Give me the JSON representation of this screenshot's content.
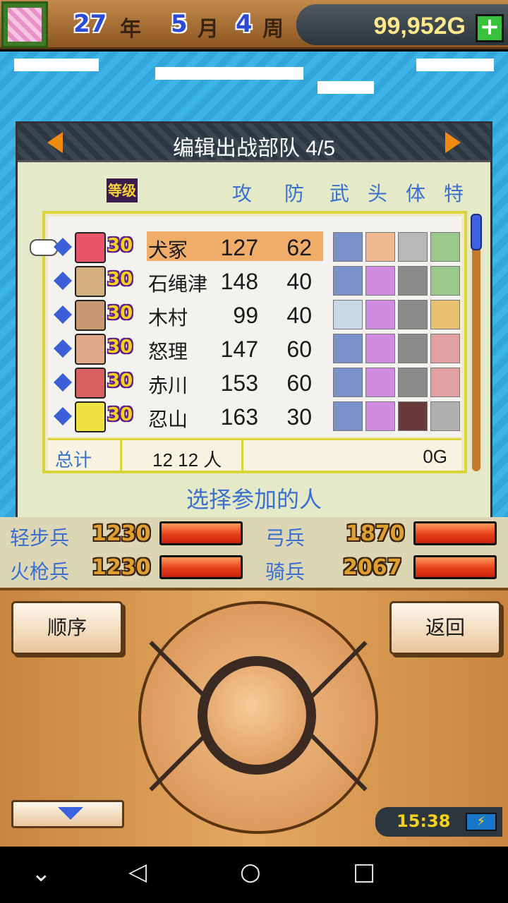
{
  "header": {
    "year": "27",
    "year_unit": "年",
    "month": "5",
    "month_unit": "月",
    "week": "4",
    "week_unit": "周",
    "gold": "99,952G",
    "plus_label": "+"
  },
  "dialog": {
    "title": "编辑出战部队 4/5",
    "level_header": "等级",
    "columns": [
      "攻",
      "防",
      "武",
      "头",
      "体",
      "特"
    ],
    "units": [
      {
        "level": "30",
        "name": "犬冢",
        "attack": "127",
        "defense": "62",
        "selected": true
      },
      {
        "level": "30",
        "name": "石绳津",
        "attack": "148",
        "defense": "40",
        "selected": false
      },
      {
        "level": "30",
        "name": "木村",
        "attack": "99",
        "defense": "40",
        "selected": false
      },
      {
        "level": "30",
        "name": "怒理",
        "attack": "147",
        "defense": "60",
        "selected": false
      },
      {
        "level": "30",
        "name": "赤川",
        "attack": "153",
        "defense": "60",
        "selected": false
      },
      {
        "level": "30",
        "name": "忍山",
        "attack": "163",
        "defense": "30",
        "selected": false
      }
    ],
    "total_label": "总计",
    "total_count": "12  12 人",
    "total_gold": "0G",
    "hint": "选择参加的人"
  },
  "troops": [
    {
      "label": "轻步兵",
      "value": "1230",
      "fill": 1.0
    },
    {
      "label": "弓兵",
      "value": "1870",
      "fill": 1.0
    },
    {
      "label": "火枪兵",
      "value": "1230",
      "fill": 1.0
    },
    {
      "label": "骑兵",
      "value": "2067",
      "fill": 1.0
    }
  ],
  "controller": {
    "order_label": "顺序",
    "back_label": "返回",
    "clock": "15:38"
  },
  "colors": {
    "accent_blue": "#3b6fd0",
    "selected_row": "#f0ad6a",
    "gold_text": "#ffe98a"
  }
}
